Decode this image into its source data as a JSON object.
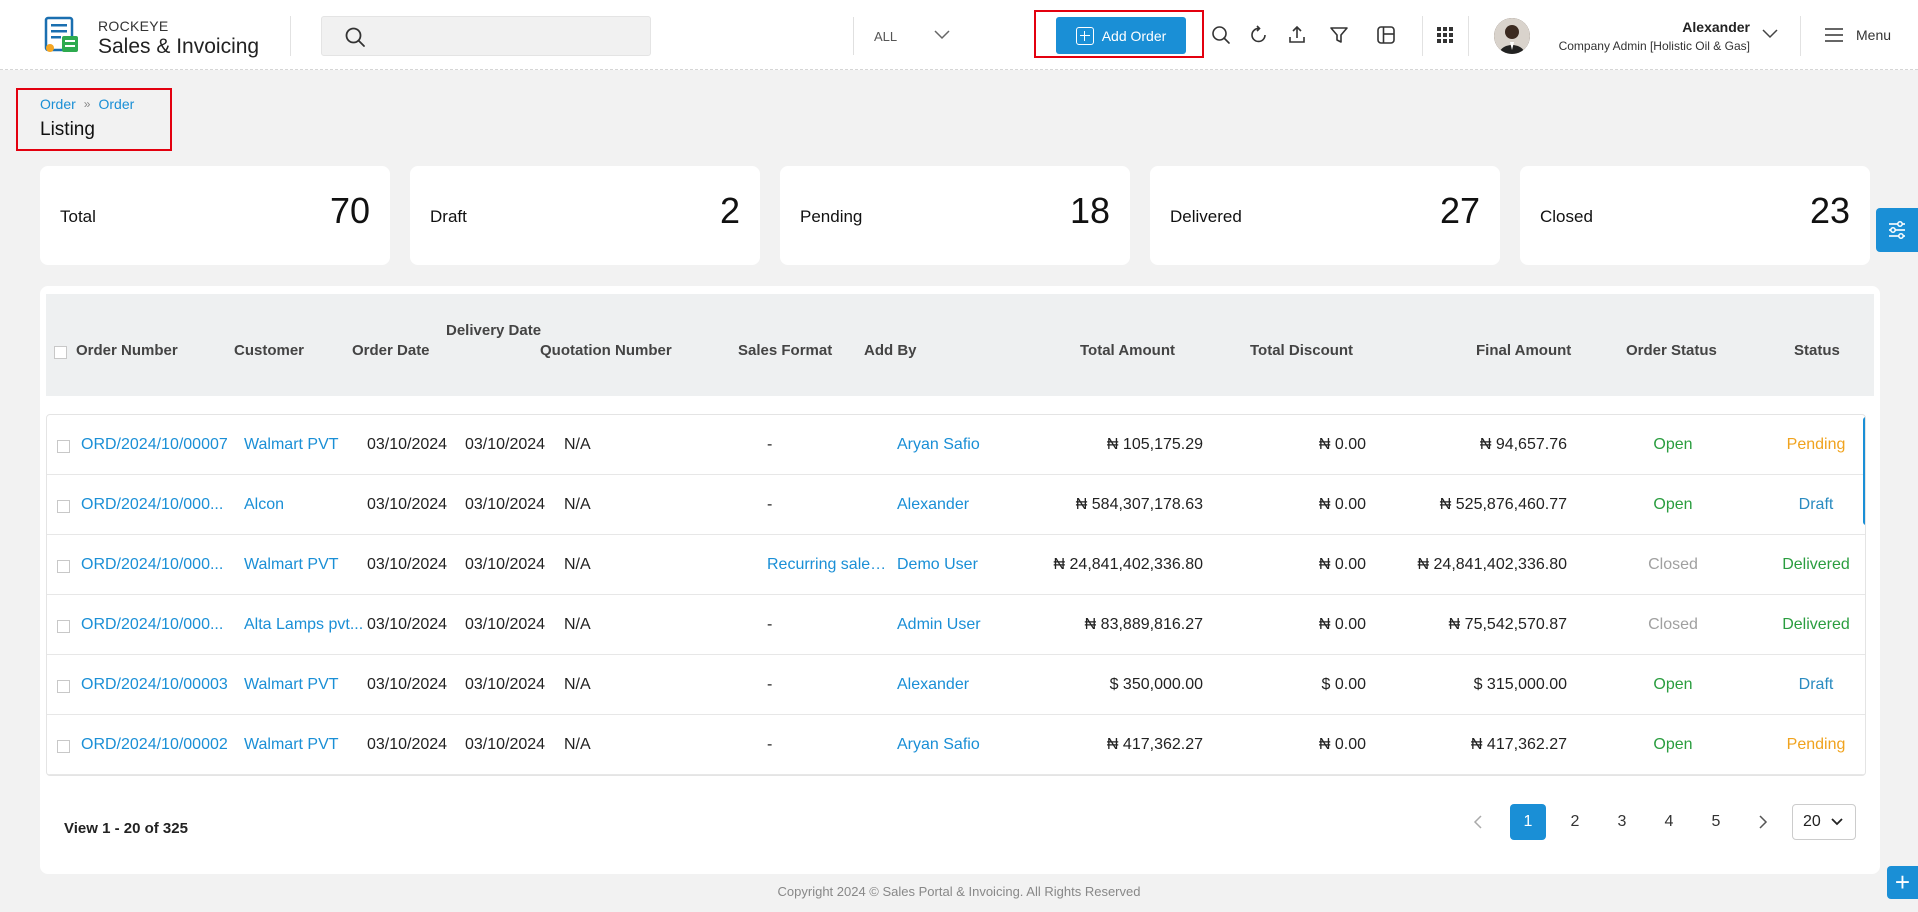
{
  "brand": {
    "top": "ROCKEYE",
    "main": "Sales & Invoicing"
  },
  "search": {
    "value": "",
    "placeholder": "",
    "scope": "ALL"
  },
  "header": {
    "add_order_label": "Add Order",
    "tools": [
      "search-icon",
      "refresh-icon",
      "export-icon",
      "filter-icon",
      "column-icon",
      "apps-grid-icon"
    ],
    "menu_label": "Menu"
  },
  "user": {
    "name": "Alexander",
    "role": "Company Admin [Holistic Oil & Gas]"
  },
  "breadcrumb": {
    "items": [
      "Order",
      "Order"
    ],
    "title": "Listing"
  },
  "stats": [
    {
      "label": "Total",
      "value": "70"
    },
    {
      "label": "Draft",
      "value": "2"
    },
    {
      "label": "Pending",
      "value": "18"
    },
    {
      "label": "Delivered",
      "value": "27"
    },
    {
      "label": "Closed",
      "value": "23"
    }
  ],
  "table": {
    "columns": {
      "order_number": "Order Number",
      "customer": "Customer",
      "order_date": "Order Date",
      "delivery_date": "Delivery Date",
      "quotation_number": "Quotation Number",
      "sales_format": "Sales Format",
      "add_by": "Add By",
      "total_amount": "Total Amount",
      "total_discount": "Total Discount",
      "final_amount": "Final Amount",
      "order_status": "Order Status",
      "status": "Status"
    },
    "rows": [
      {
        "order_number": "ORD/2024/10/00007",
        "customer": "Walmart PVT",
        "order_date": "03/10/2024",
        "delivery_date": "03/10/2024",
        "quotation": "N/A",
        "sales_format": "-",
        "add_by": "Aryan Safio",
        "total": "₦ 105,175.29",
        "discount": "₦ 0.00",
        "final": "₦ 94,657.76",
        "order_status": "Open",
        "status": "Pending"
      },
      {
        "order_number": "ORD/2024/10/000...",
        "customer": "Alcon",
        "order_date": "03/10/2024",
        "delivery_date": "03/10/2024",
        "quotation": "N/A",
        "sales_format": "-",
        "add_by": "Alexander",
        "total": "₦ 584,307,178.63",
        "discount": "₦ 0.00",
        "final": "₦ 525,876,460.77",
        "order_status": "Open",
        "status": "Draft"
      },
      {
        "order_number": "ORD/2024/10/000...",
        "customer": "Walmart PVT",
        "order_date": "03/10/2024",
        "delivery_date": "03/10/2024",
        "quotation": "N/A",
        "sales_format": "Recurring sales ...",
        "add_by": "Demo User",
        "total": "₦ 24,841,402,336.80",
        "discount": "₦ 0.00",
        "final": "₦ 24,841,402,336.80",
        "order_status": "Closed",
        "status": "Delivered"
      },
      {
        "order_number": "ORD/2024/10/000...",
        "customer": "Alta Lamps pvt...",
        "order_date": "03/10/2024",
        "delivery_date": "03/10/2024",
        "quotation": "N/A",
        "sales_format": "-",
        "add_by": "Admin User",
        "total": "₦ 83,889,816.27",
        "discount": "₦ 0.00",
        "final": "₦ 75,542,570.87",
        "order_status": "Closed",
        "status": "Delivered"
      },
      {
        "order_number": "ORD/2024/10/00003",
        "customer": "Walmart PVT",
        "order_date": "03/10/2024",
        "delivery_date": "03/10/2024",
        "quotation": "N/A",
        "sales_format": "-",
        "add_by": "Alexander",
        "total": "$ 350,000.00",
        "discount": "$ 0.00",
        "final": "$ 315,000.00",
        "order_status": "Open",
        "status": "Draft"
      },
      {
        "order_number": "ORD/2024/10/00002",
        "customer": "Walmart PVT",
        "order_date": "03/10/2024",
        "delivery_date": "03/10/2024",
        "quotation": "N/A",
        "sales_format": "-",
        "add_by": "Aryan Safio",
        "total": "₦ 417,362.27",
        "discount": "₦ 0.00",
        "final": "₦ 417,362.27",
        "order_status": "Open",
        "status": "Pending"
      }
    ]
  },
  "pagination": {
    "info": "View 1 - 20 of 325",
    "pages": [
      "1",
      "2",
      "3",
      "4",
      "5"
    ],
    "active": "1",
    "page_size": "20"
  },
  "footer": "Copyright 2024 © Sales Portal & Invoicing. All Rights Reserved",
  "colors": {
    "accent": "#1a8fd6",
    "highlight_frame": "#e3000f",
    "open": "#2a9d3f",
    "pending": "#f0a31e",
    "closed": "#a0a0a0"
  }
}
